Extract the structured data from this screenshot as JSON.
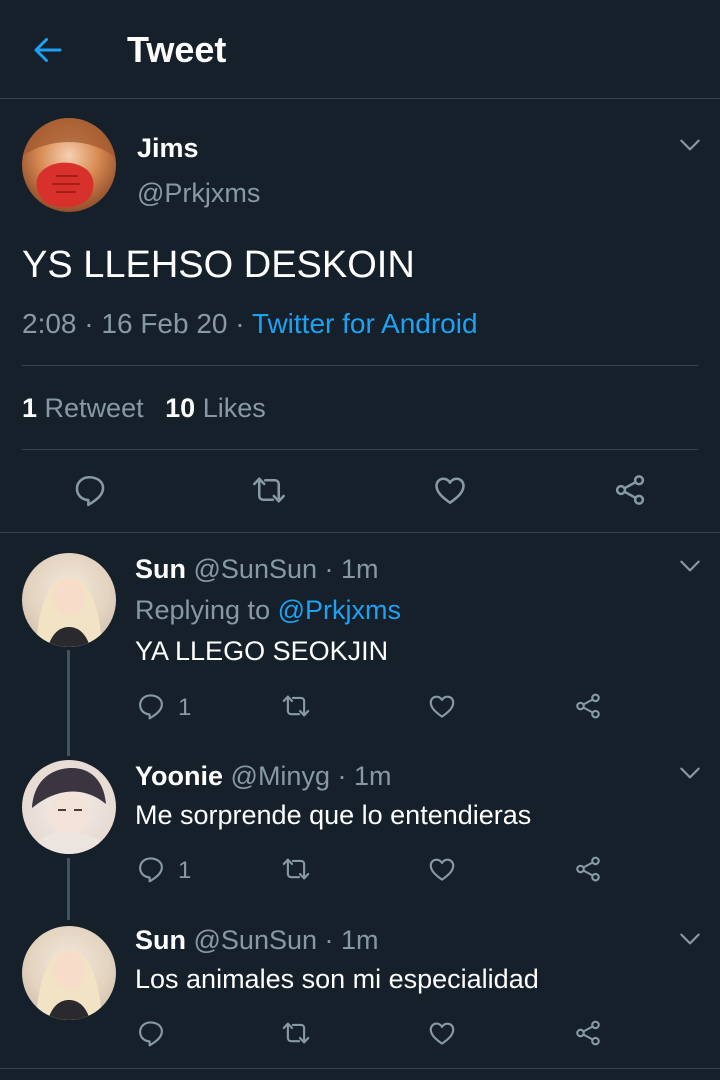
{
  "header": {
    "title": "Tweet"
  },
  "tweet": {
    "author_name": "Jims",
    "author_handle": "@Prkjxms",
    "text": "YS LLEHSO DESKOIN",
    "time": "2:08",
    "sep1": "·",
    "date": "16 Feb 20",
    "sep2": "·",
    "source": "Twitter for Android",
    "retweet_count": "1",
    "retweet_label": "Retweet",
    "like_count": "10",
    "like_label": "Likes"
  },
  "replies": [
    {
      "name": "Sun",
      "handle": "@SunSun",
      "time": "· 1m",
      "replying_label": "Replying to",
      "replying_handle": "@Prkjxms",
      "text": "YA LLEGO SEOKJIN",
      "reply_count": "1"
    },
    {
      "name": "Yoonie",
      "handle": "@Minyg",
      "time": "· 1m",
      "text": "Me sorprende que lo entendieras",
      "reply_count": "1"
    },
    {
      "name": "Sun",
      "handle": "@SunSun",
      "time": "· 1m",
      "text": "Los animales son mi especialidad",
      "reply_count": ""
    }
  ],
  "icons": {
    "back": "back-arrow-icon",
    "more": "chevron-down-icon",
    "reply": "reply-icon",
    "retweet": "retweet-icon",
    "like": "heart-icon",
    "share": "share-icon"
  },
  "colors": {
    "background": "#15202b",
    "accent": "#1da1f2",
    "muted": "#8899a6",
    "divider": "#38444d"
  }
}
